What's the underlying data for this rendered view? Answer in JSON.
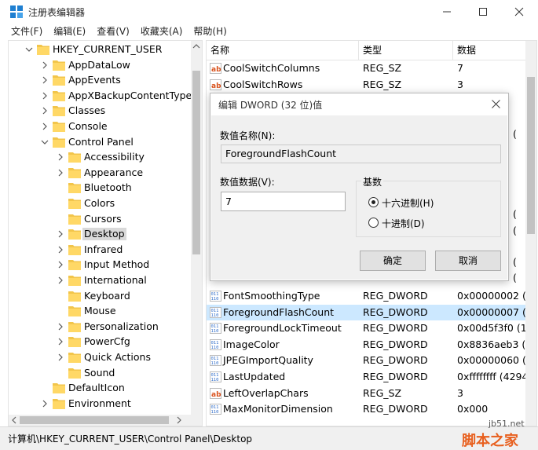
{
  "window": {
    "title": "注册表编辑器"
  },
  "menu": [
    "文件(F)",
    "编辑(E)",
    "查看(V)",
    "收藏夹(A)",
    "帮助(H)"
  ],
  "tree": [
    {
      "label": "HKEY_CURRENT_USER",
      "level": 0,
      "chev": "down"
    },
    {
      "label": "AppDataLow",
      "level": 1,
      "chev": "right"
    },
    {
      "label": "AppEvents",
      "level": 1,
      "chev": "right"
    },
    {
      "label": "AppXBackupContentType",
      "level": 1,
      "chev": "right"
    },
    {
      "label": "Classes",
      "level": 1,
      "chev": "right"
    },
    {
      "label": "Console",
      "level": 1,
      "chev": "right"
    },
    {
      "label": "Control Panel",
      "level": 1,
      "chev": "down"
    },
    {
      "label": "Accessibility",
      "level": 2,
      "chev": "right"
    },
    {
      "label": "Appearance",
      "level": 2,
      "chev": "right"
    },
    {
      "label": "Bluetooth",
      "level": 2,
      "chev": "none"
    },
    {
      "label": "Colors",
      "level": 2,
      "chev": "none"
    },
    {
      "label": "Cursors",
      "level": 2,
      "chev": "none"
    },
    {
      "label": "Desktop",
      "level": 2,
      "chev": "right",
      "selected": true
    },
    {
      "label": "Infrared",
      "level": 2,
      "chev": "right"
    },
    {
      "label": "Input Method",
      "level": 2,
      "chev": "right"
    },
    {
      "label": "International",
      "level": 2,
      "chev": "right"
    },
    {
      "label": "Keyboard",
      "level": 2,
      "chev": "none"
    },
    {
      "label": "Mouse",
      "level": 2,
      "chev": "none"
    },
    {
      "label": "Personalization",
      "level": 2,
      "chev": "right"
    },
    {
      "label": "PowerCfg",
      "level": 2,
      "chev": "right"
    },
    {
      "label": "Quick Actions",
      "level": 2,
      "chev": "right"
    },
    {
      "label": "Sound",
      "level": 2,
      "chev": "none"
    },
    {
      "label": "DefaultIcon",
      "level": 1,
      "chev": "none"
    },
    {
      "label": "Environment",
      "level": 1,
      "chev": "right"
    }
  ],
  "list": {
    "columns": [
      "名称",
      "类型",
      "数据"
    ],
    "rows_top": [
      {
        "name": "CoolSwitchColumns",
        "type": "REG_SZ",
        "data": "7",
        "icon": "string"
      },
      {
        "name": "CoolSwitchRows",
        "type": "REG_SZ",
        "data": "3",
        "icon": "string"
      }
    ],
    "rows_bottom": [
      {
        "name": "FontSmoothingType",
        "type": "REG_DWORD",
        "data": "0x00000002 (",
        "icon": "binary"
      },
      {
        "name": "ForegroundFlashCount",
        "type": "REG_DWORD",
        "data": "0x00000007 (",
        "icon": "binary",
        "highlight": true
      },
      {
        "name": "ForegroundLockTimeout",
        "type": "REG_DWORD",
        "data": "0x00d5f3f0 (1",
        "icon": "binary"
      },
      {
        "name": "ImageColor",
        "type": "REG_DWORD",
        "data": "0x8836aeb3 (",
        "icon": "binary"
      },
      {
        "name": "JPEGImportQuality",
        "type": "REG_DWORD",
        "data": "0x00000060 (",
        "icon": "binary"
      },
      {
        "name": "LastUpdated",
        "type": "REG_DWORD",
        "data": "0xffffffff (4294",
        "icon": "binary"
      },
      {
        "name": "LeftOverlapChars",
        "type": "REG_SZ",
        "data": "3",
        "icon": "string"
      },
      {
        "name": "MaxMonitorDimension",
        "type": "REG_DWORD",
        "data": "0x000",
        "icon": "binary"
      }
    ],
    "hidden_row_tails": [
      "(",
      "(",
      "(",
      "(",
      "("
    ]
  },
  "dialog": {
    "title": "编辑 DWORD (32 位)值",
    "name_label": "数值名称(N):",
    "name_value": "ForegroundFlashCount",
    "data_label": "数值数据(V):",
    "data_value": "7",
    "radix_label": "基数",
    "radix_hex": "十六进制(H)",
    "radix_dec": "十进制(D)",
    "radix_selected": "hex",
    "ok": "确定",
    "cancel": "取消"
  },
  "status": {
    "path": "计算机\\HKEY_CURRENT_USER\\Control Panel\\Desktop"
  },
  "watermark": {
    "line1": "jb51.net",
    "line2": "脚本之家"
  },
  "colors": {
    "folder": "#f2c54b",
    "selection": "#cce8ff",
    "tree_selection": "#d9d9d9",
    "string_icon": "#d9531e",
    "binary_icon": "#2e6cc9",
    "watermark": "#e8601f"
  }
}
